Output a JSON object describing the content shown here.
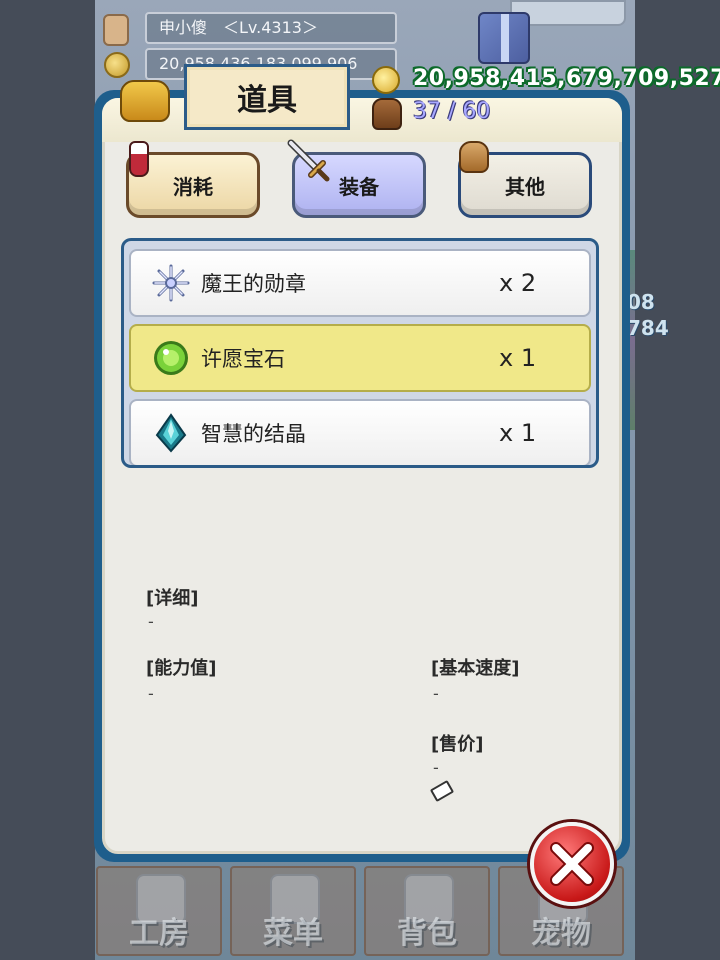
{
  "player": {
    "name_level": "申小傻　＜Lv.4313＞",
    "money_partial": "20,958,436,183,099,906"
  },
  "hud": {
    "gold": "20,958,415,679,709,527",
    "bag_capacity": "37 / 60",
    "side_numbers": [
      "08",
      "784"
    ]
  },
  "window": {
    "title": "道具"
  },
  "tabs": [
    {
      "label": "消耗",
      "icon": "potion-icon"
    },
    {
      "label": "装备",
      "icon": "sword-icon"
    },
    {
      "label": "其他",
      "icon": "sack-icon"
    }
  ],
  "items": [
    {
      "name": "魔王的勋章",
      "qty": "x 2",
      "icon": "snowflake-medal-icon"
    },
    {
      "name": "许愿宝石",
      "qty": "x 1",
      "icon": "green-gem-icon",
      "selected": true
    },
    {
      "name": "智慧的结晶",
      "qty": "x 1",
      "icon": "teal-crystal-icon"
    }
  ],
  "details": {
    "detail_label": "[详细]",
    "detail_value": "-",
    "stats_label": "[能力值]",
    "stats_value": "-",
    "speed_label": "[基本速度]",
    "speed_value": "-",
    "price_label": "[售价]",
    "price_value": "-"
  },
  "bottom_nav": [
    {
      "label": "工房",
      "icon": "workshop-icon"
    },
    {
      "label": "菜单",
      "icon": "book-icon"
    },
    {
      "label": "背包",
      "icon": "backpack-icon"
    },
    {
      "label": "宠物",
      "icon": "pet-icon"
    }
  ],
  "colors": {
    "panel_border": "#1e5e8c",
    "selected_row": "#f0e889",
    "gold_outline": "#0c6a2a",
    "close_button": "#c81818"
  }
}
